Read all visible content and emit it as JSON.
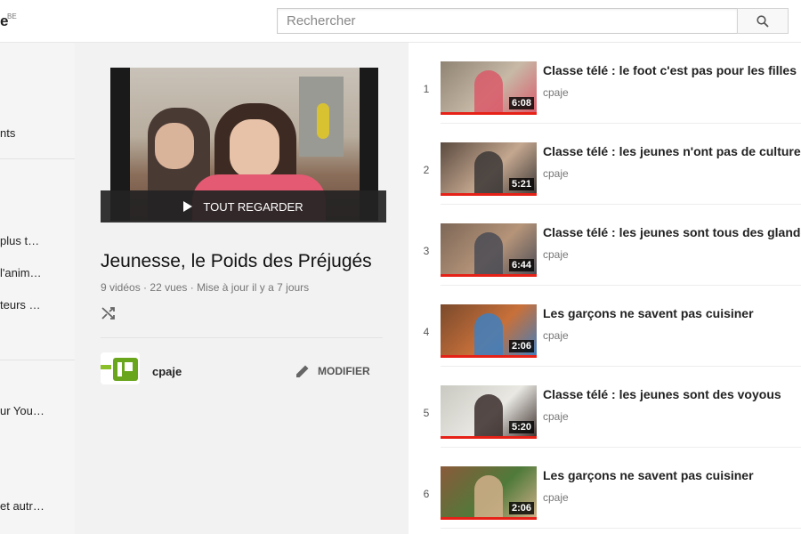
{
  "header": {
    "logo_text": "e",
    "logo_region": "BE",
    "search_placeholder": "Rechercher"
  },
  "sidebar": {
    "items": [
      "nts",
      "plus t…",
      "l'anim…",
      "teurs …",
      "ur You…",
      "et autr…"
    ]
  },
  "playlist": {
    "play_all_label": "TOUT REGARDER",
    "title": "Jeunesse, le Poids des Préjugés",
    "video_count": "9 vidéos",
    "views": "22 vues",
    "updated": "Mise à jour il y a 7 jours",
    "owner": "cpaje",
    "edit_label": "MODIFIER"
  },
  "videos": [
    {
      "index": "1",
      "title": "Classe télé : le foot c'est pas pour les filles",
      "channel": "cpaje",
      "duration": "6:08",
      "colors": [
        "#8f8373",
        "#c7b9a6",
        "#d95a6a"
      ]
    },
    {
      "index": "2",
      "title": "Classe télé : les jeunes n'ont pas de culture",
      "channel": "cpaje",
      "duration": "5:21",
      "colors": [
        "#5a4a3f",
        "#c4a78f",
        "#3b3736"
      ]
    },
    {
      "index": "3",
      "title": "Classe télé : les jeunes sont tous des glandeurs",
      "channel": "cpaje",
      "duration": "6:44",
      "colors": [
        "#7d6757",
        "#b59479",
        "#4a4b55"
      ]
    },
    {
      "index": "4",
      "title": "Les garçons ne savent pas cuisiner",
      "channel": "cpaje",
      "duration": "2:06",
      "colors": [
        "#7a4a2c",
        "#c8703a",
        "#3e7fc0"
      ]
    },
    {
      "index": "5",
      "title": "Classe télé : les jeunes sont des voyous",
      "channel": "cpaje",
      "duration": "5:20",
      "colors": [
        "#c9c9c2",
        "#e9e8e2",
        "#3a2d2a"
      ]
    },
    {
      "index": "6",
      "title": "Les garçons ne savent pas cuisiner",
      "channel": "cpaje",
      "duration": "2:06",
      "colors": [
        "#8a5a3a",
        "#4f7a3a",
        "#d2b08a"
      ]
    }
  ]
}
